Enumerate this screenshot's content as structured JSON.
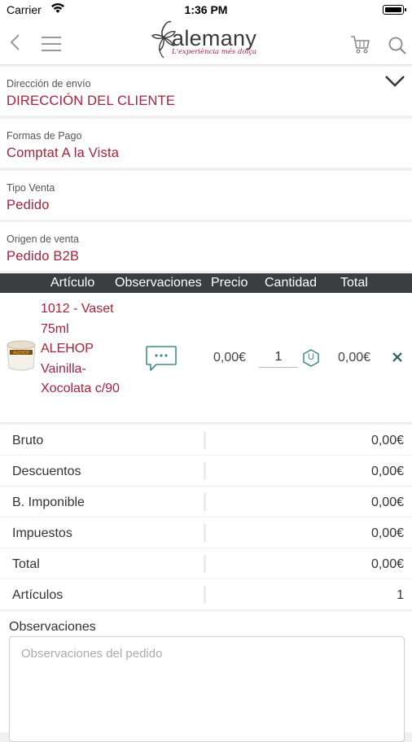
{
  "status_bar": {
    "carrier": "Carrier",
    "time": "1:36 PM"
  },
  "header": {
    "brand": "alemany",
    "tagline": "L'experiència més dolça"
  },
  "icons": {
    "back": "chevron-left-icon",
    "menu": "hamburger-menu-icon",
    "cart": "cart-icon",
    "search": "search-icon",
    "expand": "chevron-down-icon",
    "observations": "chat-bubble-icon",
    "unit": "unit-hexagon-icon",
    "remove": "close-icon"
  },
  "colors": {
    "accent": "#a3243b",
    "table_header": "#3b3e40",
    "remove": "#2e5e5a",
    "unit": "#3d8c85"
  },
  "shipping": {
    "label": "Dirección de envío",
    "value": "DIRECCIÓN DEL CLIENTE"
  },
  "payment": {
    "label": "Formas de Pago",
    "value": "Comptat A la Vista"
  },
  "sale_type": {
    "label": "Tipo Venta",
    "value": "Pedido"
  },
  "sale_origin": {
    "label": "Origen de venta",
    "value": "Pedido B2B"
  },
  "table": {
    "headers": [
      "Artículo",
      "Observaciones",
      "Precio",
      "Cantidad",
      "Total"
    ],
    "rows": [
      {
        "name": "1012 - Vaset 75ml ALEHOP Vainilla-Xocolata c/90",
        "price": "0,00€",
        "quantity": "1",
        "unit": "U",
        "total": "0,00€"
      }
    ]
  },
  "summary": [
    {
      "label": "Bruto",
      "value": "0,00€"
    },
    {
      "label": "Descuentos",
      "value": "0,00€"
    },
    {
      "label": "B. Imponible",
      "value": "0,00€"
    },
    {
      "label": "Impuestos",
      "value": "0,00€"
    },
    {
      "label": "Total",
      "value": "0,00€"
    },
    {
      "label": "Artículos",
      "value": "1"
    }
  ],
  "observations": {
    "label": "Observaciones",
    "placeholder": "Observaciones del pedido"
  }
}
